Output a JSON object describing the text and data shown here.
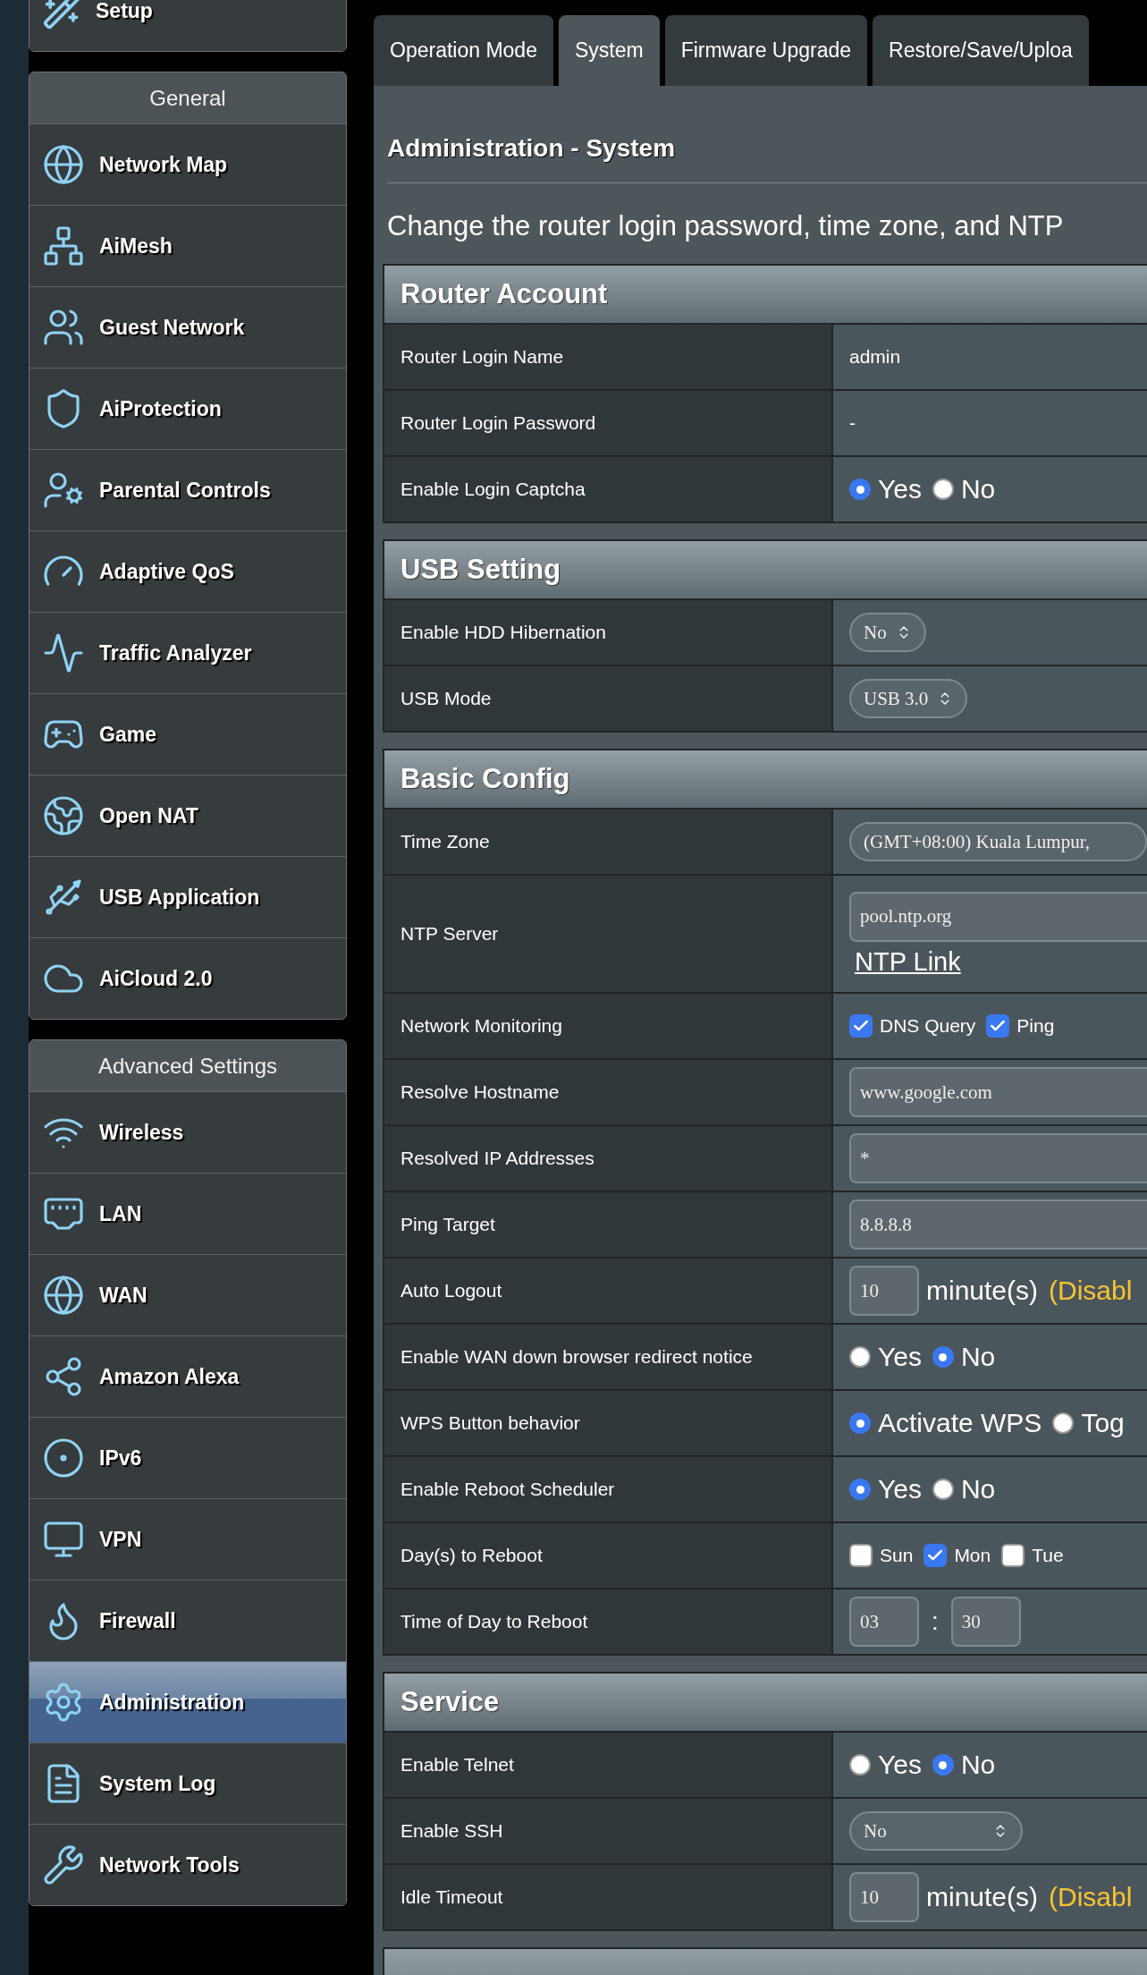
{
  "sidebar": {
    "top_item": {
      "label": "Setup"
    },
    "groups": [
      {
        "title": "General",
        "items": [
          {
            "label": "Network Map",
            "selected": false
          },
          {
            "label": "AiMesh",
            "selected": false
          },
          {
            "label": "Guest Network",
            "selected": false
          },
          {
            "label": "AiProtection",
            "selected": false
          },
          {
            "label": "Parental Controls",
            "selected": false
          },
          {
            "label": "Adaptive QoS",
            "selected": false
          },
          {
            "label": "Traffic Analyzer",
            "selected": false
          },
          {
            "label": "Game",
            "selected": false
          },
          {
            "label": "Open NAT",
            "selected": false
          },
          {
            "label": "USB Application",
            "selected": false
          },
          {
            "label": "AiCloud 2.0",
            "selected": false
          }
        ]
      },
      {
        "title": "Advanced Settings",
        "items": [
          {
            "label": "Wireless",
            "selected": false
          },
          {
            "label": "LAN",
            "selected": false
          },
          {
            "label": "WAN",
            "selected": false
          },
          {
            "label": "Amazon Alexa",
            "selected": false
          },
          {
            "label": "IPv6",
            "selected": false
          },
          {
            "label": "VPN",
            "selected": false
          },
          {
            "label": "Firewall",
            "selected": false
          },
          {
            "label": "Administration",
            "selected": true
          },
          {
            "label": "System Log",
            "selected": false
          },
          {
            "label": "Network Tools",
            "selected": false
          }
        ]
      }
    ]
  },
  "tabs": [
    {
      "label": "Operation Mode",
      "selected": false
    },
    {
      "label": "System",
      "selected": true
    },
    {
      "label": "Firmware Upgrade",
      "selected": false
    },
    {
      "label": "Restore/Save/Uploa",
      "selected": false
    }
  ],
  "heading": "Administration - System",
  "description": "Change the router login password, time zone, and NTP",
  "sections": [
    {
      "title": "Router Account",
      "rows": [
        {
          "label": "Router Login Name",
          "kind": "text",
          "value": "admin"
        },
        {
          "label": "Router Login Password",
          "kind": "text",
          "value": "-"
        },
        {
          "label": "Enable Login Captcha",
          "kind": "radio",
          "options": [
            {
              "label": "Yes",
              "selected": true
            },
            {
              "label": "No",
              "selected": false
            }
          ]
        }
      ]
    },
    {
      "title": "USB Setting",
      "rows": [
        {
          "label": "Enable HDD Hibernation",
          "kind": "select",
          "value": "No"
        },
        {
          "label": "USB Mode",
          "kind": "select",
          "value": "USB 3.0"
        }
      ]
    },
    {
      "title": "Basic Config",
      "rows": [
        {
          "label": "Time Zone",
          "kind": "wideselect",
          "value": "(GMT+08:00) Kuala Lumpur,"
        },
        {
          "label": "NTP Server",
          "kind": "inputlink",
          "value": "pool.ntp.org",
          "link": "NTP Link"
        },
        {
          "label": "Network Monitoring",
          "kind": "checks",
          "options": [
            {
              "label": "DNS Query",
              "checked": true
            },
            {
              "label": "Ping",
              "checked": true
            }
          ]
        },
        {
          "label": "Resolve Hostname",
          "kind": "input",
          "value": "www.google.com"
        },
        {
          "label": "Resolved IP Addresses",
          "kind": "input",
          "value": "*"
        },
        {
          "label": "Ping Target",
          "kind": "input",
          "value": "8.8.8.8"
        },
        {
          "label": "Auto Logout",
          "kind": "minutes",
          "value": "10",
          "unit": "minute(s)",
          "note": "(Disabl"
        },
        {
          "label": "Enable WAN down browser redirect notice",
          "kind": "radio",
          "options": [
            {
              "label": "Yes",
              "selected": false
            },
            {
              "label": "No",
              "selected": true
            }
          ]
        },
        {
          "label": "WPS Button behavior",
          "kind": "radio",
          "options": [
            {
              "label": "Activate WPS",
              "selected": true
            },
            {
              "label": "Tog",
              "selected": false
            }
          ]
        },
        {
          "label": "Enable Reboot Scheduler",
          "kind": "radio",
          "options": [
            {
              "label": "Yes",
              "selected": true
            },
            {
              "label": "No",
              "selected": false
            }
          ]
        },
        {
          "label": "Day(s) to Reboot",
          "kind": "checks",
          "options": [
            {
              "label": "Sun",
              "checked": false
            },
            {
              "label": "Mon",
              "checked": true
            },
            {
              "label": "Tue",
              "checked": false
            }
          ]
        },
        {
          "label": "Time of Day to Reboot",
          "kind": "time",
          "hour": "03",
          "separator": ":",
          "minute": "30"
        }
      ]
    },
    {
      "title": "Service",
      "rows": [
        {
          "label": "Enable Telnet",
          "kind": "radio",
          "options": [
            {
              "label": "Yes",
              "selected": false
            },
            {
              "label": "No",
              "selected": true
            }
          ]
        },
        {
          "label": "Enable SSH",
          "kind": "longselect",
          "value": "No"
        },
        {
          "label": "Idle Timeout",
          "kind": "minutes",
          "value": "10",
          "unit": "minute(s)",
          "note": "(Disabl"
        }
      ]
    }
  ]
}
